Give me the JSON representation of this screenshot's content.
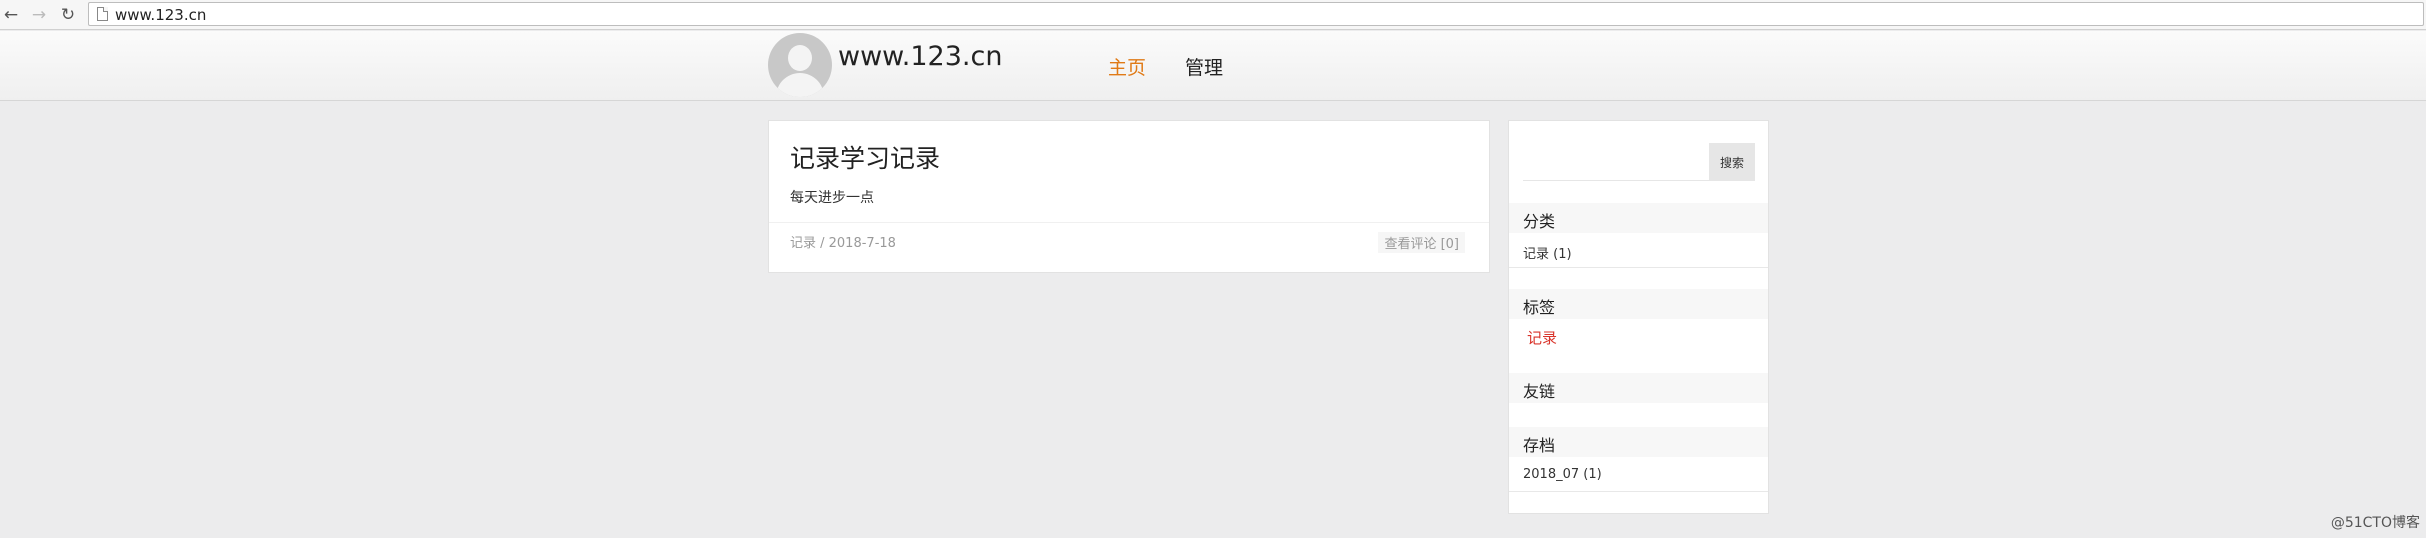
{
  "browser": {
    "back_icon": "←",
    "forward_icon": "→",
    "reload_icon": "↻",
    "url": "www.123.cn"
  },
  "header": {
    "site_title": "www.123.cn",
    "nav": [
      {
        "label": "主页",
        "active": true
      },
      {
        "label": "管理",
        "active": false
      }
    ],
    "accent_color": "#e07a16"
  },
  "post": {
    "title": "记录学习记录",
    "summary": "每天进步一点",
    "meta": "记录 / 2018-7-18",
    "comments": "查看评论 [0]"
  },
  "sidebar": {
    "search": {
      "value": "",
      "button_label": "搜索"
    },
    "categories": {
      "title": "分类",
      "items": [
        "记录 (1)"
      ]
    },
    "tags": {
      "title": "标签",
      "items": [
        "记录"
      ],
      "color": "#d9342b"
    },
    "links": {
      "title": "友链",
      "items": []
    },
    "archive": {
      "title": "存档",
      "items": [
        "2018_07 (1)"
      ]
    }
  },
  "watermark": "@51CTO博客"
}
